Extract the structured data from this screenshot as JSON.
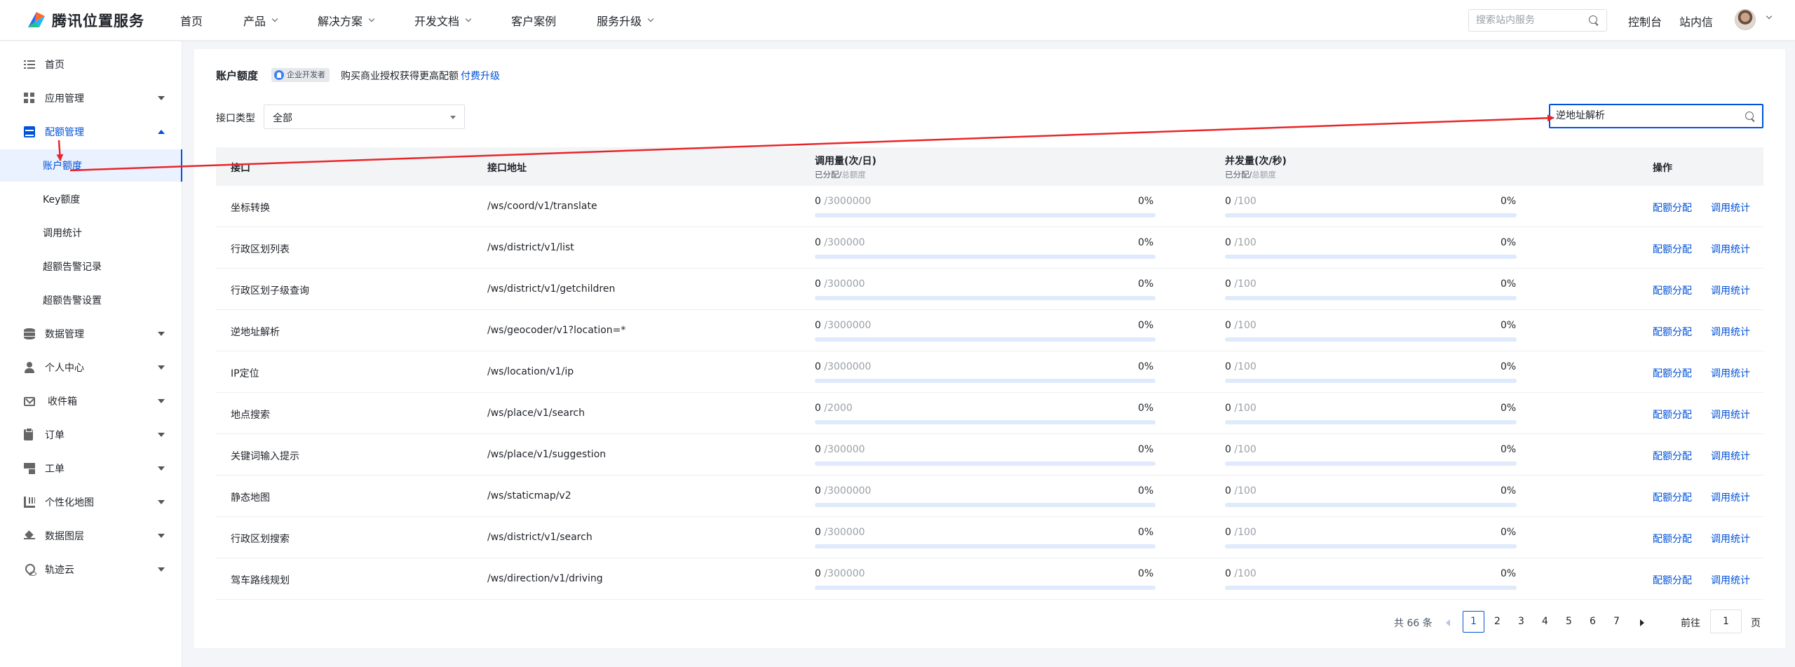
{
  "brand": {
    "name": "腾讯位置服务"
  },
  "topnav": [
    {
      "label": "首页",
      "dropdown": false
    },
    {
      "label": "产品",
      "dropdown": true
    },
    {
      "label": "解决方案",
      "dropdown": true
    },
    {
      "label": "开发文档",
      "dropdown": true
    },
    {
      "label": "客户案例",
      "dropdown": false
    },
    {
      "label": "服务升级",
      "dropdown": true
    }
  ],
  "header": {
    "search_placeholder": "搜索站内服务",
    "console": "控制台",
    "messages": "站内信"
  },
  "sidebar": {
    "home": "首页",
    "app_mgmt": "应用管理",
    "quota_mgmt": "配额管理",
    "sub": [
      "账户额度",
      "Key额度",
      "调用统计",
      "超额告警记录",
      "超额告警设置"
    ],
    "data_mgmt": "数据管理",
    "personal": "个人中心",
    "inbox": "收件箱",
    "orders": "订单",
    "tickets": "工单",
    "custom_map": "个性化地图",
    "data_layer": "数据图层",
    "track_cloud": "轨迹云"
  },
  "main": {
    "title": "账户额度",
    "badge": "企业开发者",
    "notice": "购买商业授权获得更高配额",
    "notice_link": "付费升级",
    "filter_label": "接口类型",
    "filter_value": "全部",
    "search_value": "逆地址解析"
  },
  "table": {
    "headers": {
      "api": "接口",
      "url": "接口地址",
      "daily": "调用量(次/日)",
      "concurrency": "并发量(次/秒)",
      "sub_allocated": "已分配/",
      "sub_total": "总额度",
      "ops": "操作"
    },
    "op_allocate": "配额分配",
    "op_stats": "调用统计",
    "rows": [
      {
        "name": "坐标转换",
        "url": "/ws/coord/v1/translate",
        "daily_used": "0",
        "daily_total": "/3000000",
        "daily_pct": "0%",
        "daily_ratio": 0,
        "conc_used": "0",
        "conc_total": "/100",
        "conc_pct": "0%",
        "conc_ratio": 0
      },
      {
        "name": "行政区划列表",
        "url": "/ws/district/v1/list",
        "daily_used": "0",
        "daily_total": "/300000",
        "daily_pct": "0%",
        "daily_ratio": 0,
        "conc_used": "0",
        "conc_total": "/100",
        "conc_pct": "0%",
        "conc_ratio": 0
      },
      {
        "name": "行政区划子级查询",
        "url": "/ws/district/v1/getchildren",
        "daily_used": "0",
        "daily_total": "/300000",
        "daily_pct": "0%",
        "daily_ratio": 0,
        "conc_used": "0",
        "conc_total": "/100",
        "conc_pct": "0%",
        "conc_ratio": 0
      },
      {
        "name": "逆地址解析",
        "url": "/ws/geocoder/v1?location=*",
        "daily_used": "0",
        "daily_total": "/3000000",
        "daily_pct": "0%",
        "daily_ratio": 0,
        "conc_used": "0",
        "conc_total": "/100",
        "conc_pct": "0%",
        "conc_ratio": 0
      },
      {
        "name": "IP定位",
        "url": "/ws/location/v1/ip",
        "daily_used": "0",
        "daily_total": "/3000000",
        "daily_pct": "0%",
        "daily_ratio": 0,
        "conc_used": "0",
        "conc_total": "/100",
        "conc_pct": "0%",
        "conc_ratio": 0
      },
      {
        "name": "地点搜索",
        "url": "/ws/place/v1/search",
        "daily_used": "0",
        "daily_total": "/2000",
        "daily_pct": "0%",
        "daily_ratio": 0,
        "conc_used": "0",
        "conc_total": "/100",
        "conc_pct": "0%",
        "conc_ratio": 0
      },
      {
        "name": "关键词输入提示",
        "url": "/ws/place/v1/suggestion",
        "daily_used": "0",
        "daily_total": "/300000",
        "daily_pct": "0%",
        "daily_ratio": 0,
        "conc_used": "0",
        "conc_total": "/100",
        "conc_pct": "0%",
        "conc_ratio": 0
      },
      {
        "name": "静态地图",
        "url": "/ws/staticmap/v2",
        "daily_used": "0",
        "daily_total": "/3000000",
        "daily_pct": "0%",
        "daily_ratio": 0,
        "conc_used": "0",
        "conc_total": "/100",
        "conc_pct": "0%",
        "conc_ratio": 0
      },
      {
        "name": "行政区划搜索",
        "url": "/ws/district/v1/search",
        "daily_used": "0",
        "daily_total": "/300000",
        "daily_pct": "0%",
        "daily_ratio": 0,
        "conc_used": "0",
        "conc_total": "/100",
        "conc_pct": "0%",
        "conc_ratio": 0
      },
      {
        "name": "驾车路线规划",
        "url": "/ws/direction/v1/driving",
        "daily_used": "0",
        "daily_total": "/300000",
        "daily_pct": "0%",
        "daily_ratio": 0,
        "conc_used": "0",
        "conc_total": "/100",
        "conc_pct": "0%",
        "conc_ratio": 0
      }
    ]
  },
  "pagination": {
    "total": "共 66 条",
    "pages": [
      "1",
      "2",
      "3",
      "4",
      "5",
      "6",
      "7"
    ],
    "current": "1",
    "goto_label": "前往",
    "goto_value": "1",
    "goto_unit": "页"
  },
  "colors": {
    "accent": "#0052d9",
    "annotation": "#e8262a"
  }
}
